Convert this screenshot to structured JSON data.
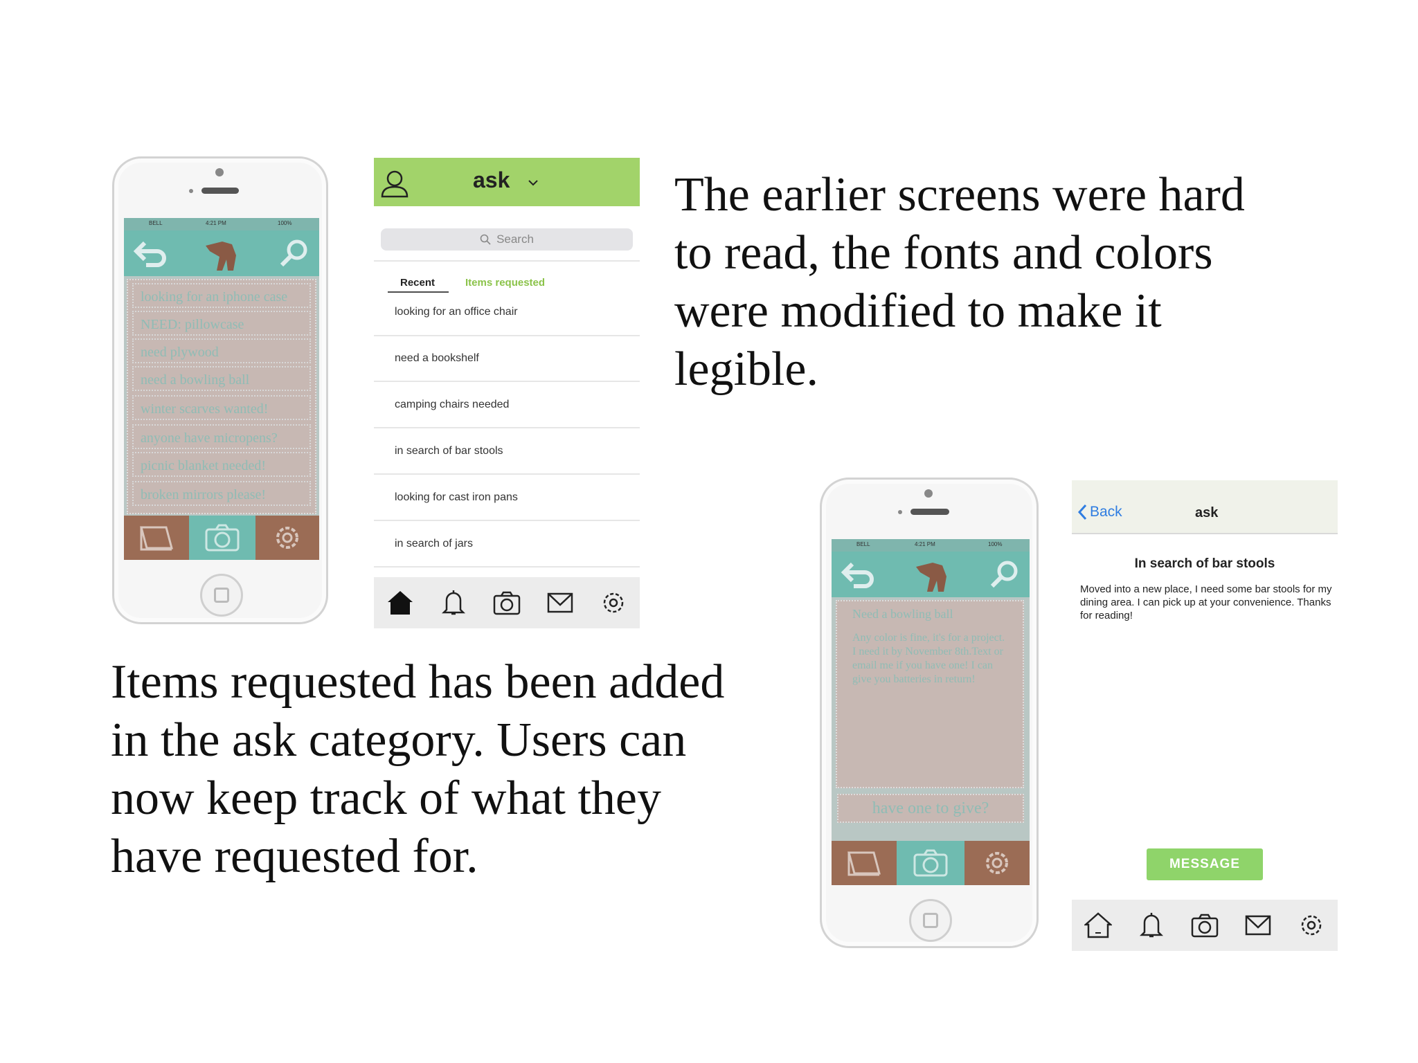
{
  "captions": {
    "top_right_lines": [
      "The earlier screens were hard",
      "to read, the fonts and colors",
      "were modified to make it",
      "legible."
    ],
    "bottom_left_lines": [
      "Items requested has been added",
      "in the ask category. Users can",
      "now keep track of what they",
      "have requested for."
    ]
  },
  "old_phone_list": {
    "status_carrier": "BELL",
    "status_time": "4:21 PM",
    "status_battery": "100%",
    "items": [
      "looking for an iphone case",
      "NEED: pillowcase",
      "need plywood",
      "need a bowling ball",
      "winter scarves wanted!",
      "anyone have micropens?",
      "picnic blanket needed!",
      "broken mirrors please!"
    ]
  },
  "ask_screen": {
    "title": "ask",
    "search_placeholder": "Search",
    "tabs": [
      "Recent",
      "Items requested"
    ],
    "items": [
      "looking for an office chair",
      "need a bookshelf",
      "camping chairs needed",
      "in search of bar stools",
      "looking for cast iron pans",
      "in search of jars"
    ]
  },
  "old_phone_detail": {
    "status_carrier": "BELL",
    "status_time": "4:21 PM",
    "status_battery": "100%",
    "title": "Need a bowling ball",
    "body": "Any color is fine, it's for a project. I need it by November 8th.Text or email me if you have one! I can give you batteries in return!",
    "give_button": "have one to give?"
  },
  "detail_screen": {
    "back_label": "Back",
    "header_title": "ask",
    "item_title": "In search of bar stools",
    "body": "Moved into a new place, I need some bar stools for my dining area. I can pick up at your convenience. Thanks for reading!",
    "message_button": "MESSAGE"
  },
  "colors": {
    "accent_green": "#a2d36a",
    "old_teal": "#6fbbb0",
    "old_brown": "#9b6c55"
  }
}
